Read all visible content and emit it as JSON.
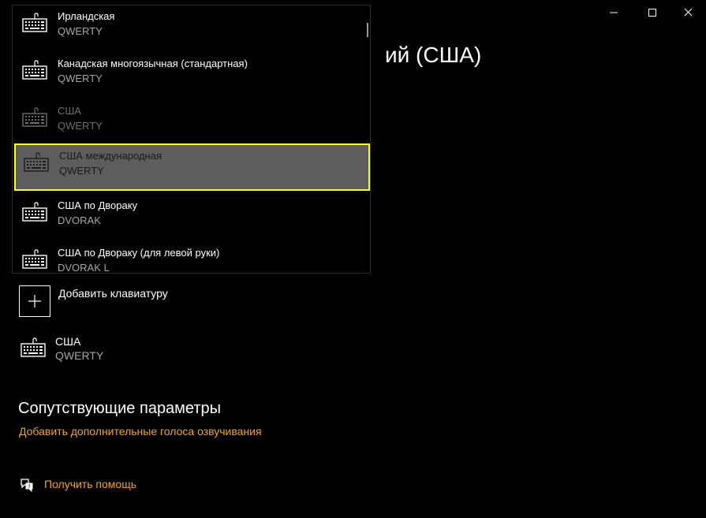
{
  "window": {
    "title_visible_suffix": "ий (США)"
  },
  "dropdown": {
    "items": [
      {
        "name": "Ирландская",
        "layout": "QWERTY",
        "state": "normal"
      },
      {
        "name": "Канадская многоязычная (стандартная)",
        "layout": "QWERTY",
        "state": "normal"
      },
      {
        "name": "США",
        "layout": "QWERTY",
        "state": "disabled"
      },
      {
        "name": "США международная",
        "layout": "QWERTY",
        "state": "selected"
      },
      {
        "name": "США по Двораку",
        "layout": "DVORAK",
        "state": "normal"
      },
      {
        "name": "США по Двораку (для левой руки)",
        "layout": "DVORAK L",
        "state": "normal"
      }
    ]
  },
  "keyboards": {
    "add_label": "Добавить клавиатуру",
    "installed": {
      "name": "США",
      "layout": "QWERTY"
    }
  },
  "related": {
    "header": "Сопутствующие параметры",
    "voice_link": "Добавить дополнительные голоса озвучивания"
  },
  "help": {
    "label": "Получить помощь"
  },
  "colors": {
    "background": "#000000",
    "accent_link": "#f4a21c",
    "focus_outline": "#ffff00",
    "selected_bg": "#5d5d5d",
    "disabled_text": "#6e6e6e",
    "secondary_text": "#a6a6a6"
  },
  "icons": [
    "back-arrow-icon",
    "minimize-icon",
    "maximize-icon",
    "close-icon",
    "keyboard-icon",
    "plus-icon",
    "help-chat-icon"
  ]
}
